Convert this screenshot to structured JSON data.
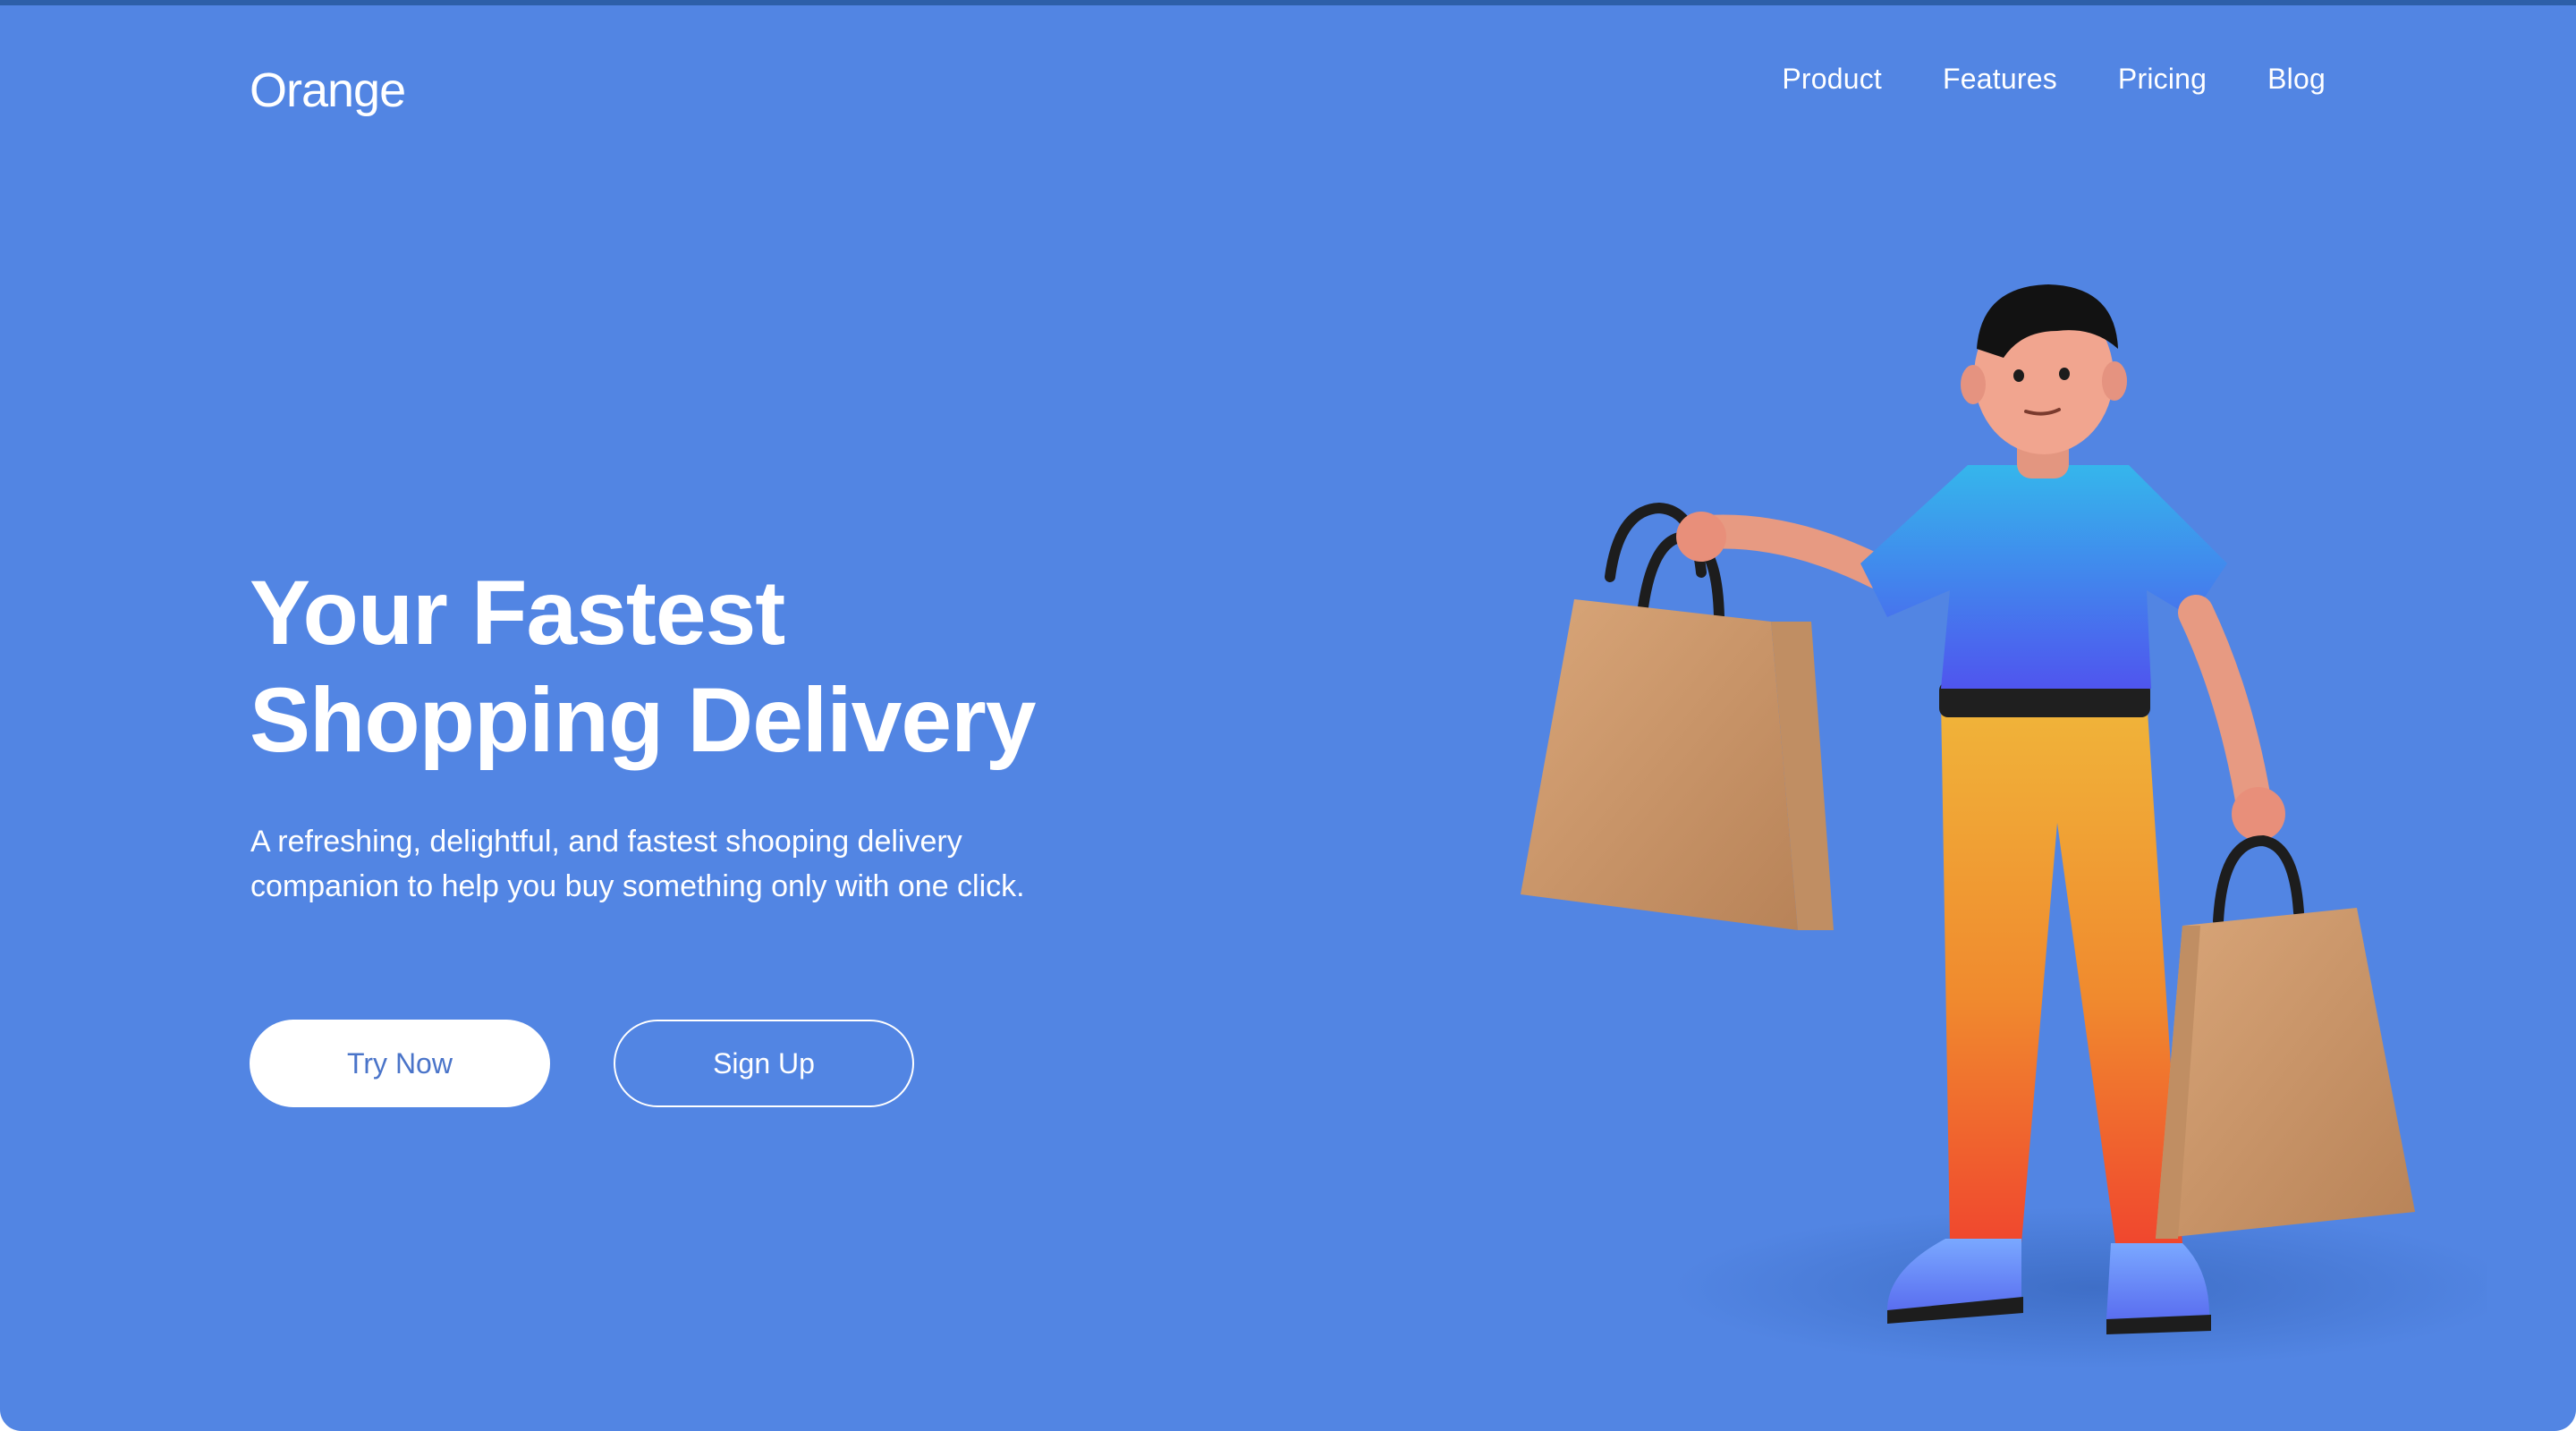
{
  "brand": {
    "name": "Orange"
  },
  "nav": {
    "items": [
      {
        "label": "Product"
      },
      {
        "label": "Features"
      },
      {
        "label": "Pricing"
      },
      {
        "label": "Blog"
      }
    ]
  },
  "hero": {
    "title_line1": "Your Fastest",
    "title_line2": "Shopping Delivery",
    "description_line1": "A refreshing, delightful, and fastest shooping delivery",
    "description_line2": "companion to help you buy something only with one click.",
    "primary_button": "Try Now",
    "secondary_button": "Sign Up"
  },
  "illustration": {
    "icon": "shopper-with-bags-illustration"
  },
  "colors": {
    "background": "#5285e3",
    "text": "#ffffff",
    "primary_button_text": "#4a74c9"
  }
}
